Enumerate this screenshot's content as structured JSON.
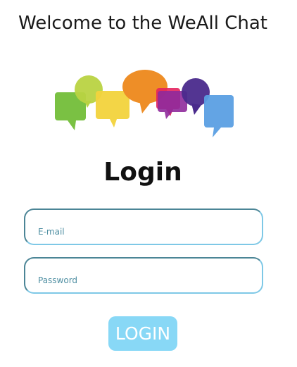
{
  "header": {
    "welcome_text": "Welcome to the WeAll Chat"
  },
  "logo": {
    "icon": "speech-bubbles-logo",
    "colors": [
      "#7ac143",
      "#b9d342",
      "#f2d33c",
      "#ee8e27",
      "#e4245e",
      "#8f2a9b",
      "#4a2a8c",
      "#5b9fe3"
    ]
  },
  "form": {
    "title": "Login",
    "email_placeholder": "E-mail",
    "password_placeholder": "Password",
    "submit_label": "LOGIN"
  },
  "theme": {
    "button_color": "#88d8f6",
    "field_border_light": "#7ec8e6",
    "field_border_dark": "#4b8596"
  }
}
